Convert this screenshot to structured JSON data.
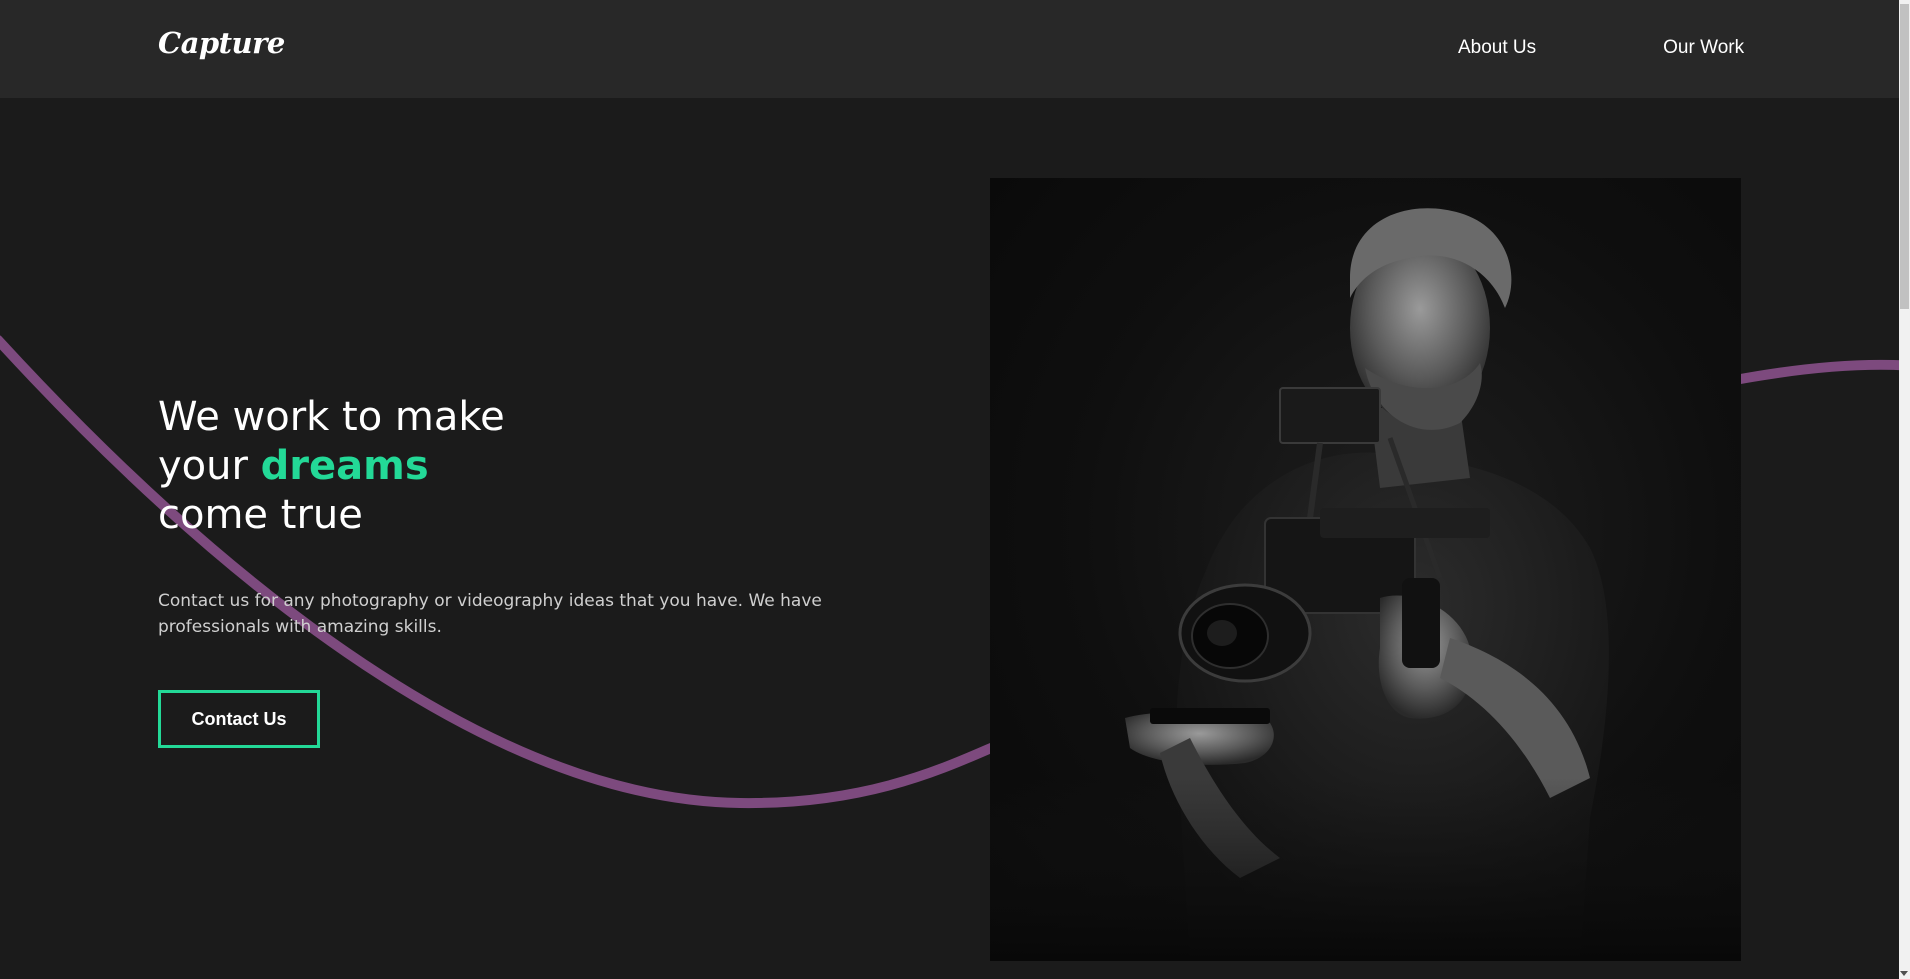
{
  "brand": {
    "logo_text": "Capture"
  },
  "nav": {
    "links": [
      {
        "label": "About Us"
      },
      {
        "label": "Our Work"
      }
    ]
  },
  "hero": {
    "headline_line1": "We work to make",
    "headline_line2_prefix": "your",
    "headline_accent": "dreams",
    "headline_line3": "come true",
    "description": "Contact us for any photography or videography ideas that you have. We have professionals with amazing skills.",
    "cta_label": "Contact Us"
  },
  "colors": {
    "background": "#1b1b1b",
    "navbar": "#282828",
    "accent": "#23d997",
    "wave": "#7d4a7e"
  }
}
